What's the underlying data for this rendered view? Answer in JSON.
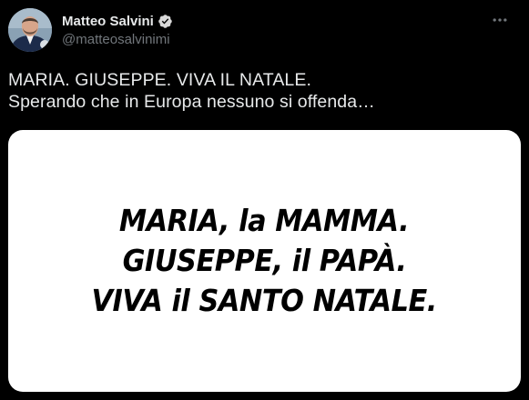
{
  "author": {
    "display_name": "Matteo Salvini",
    "handle": "@matteosalvinimi",
    "verified": true,
    "verified_color": "#d9d9d9"
  },
  "tweet": {
    "text_lines": [
      "MARIA. GIUSEPPE. VIVA IL NATALE.",
      "Sperando che in Europa nessuno si offenda…"
    ]
  },
  "media": {
    "image_text_lines": [
      "MARIA, la MAMMA.",
      "GIUSEPPE, il PAPÀ.",
      "VIVA il SANTO NATALE."
    ],
    "background_color": "#ffffff",
    "text_color": "#000000"
  },
  "icons": {
    "more": "more-options-icon",
    "verified": "verified-badge-icon"
  },
  "colors": {
    "background": "#000000",
    "primary_text": "#e7e9ea",
    "secondary_text": "#71767b"
  }
}
